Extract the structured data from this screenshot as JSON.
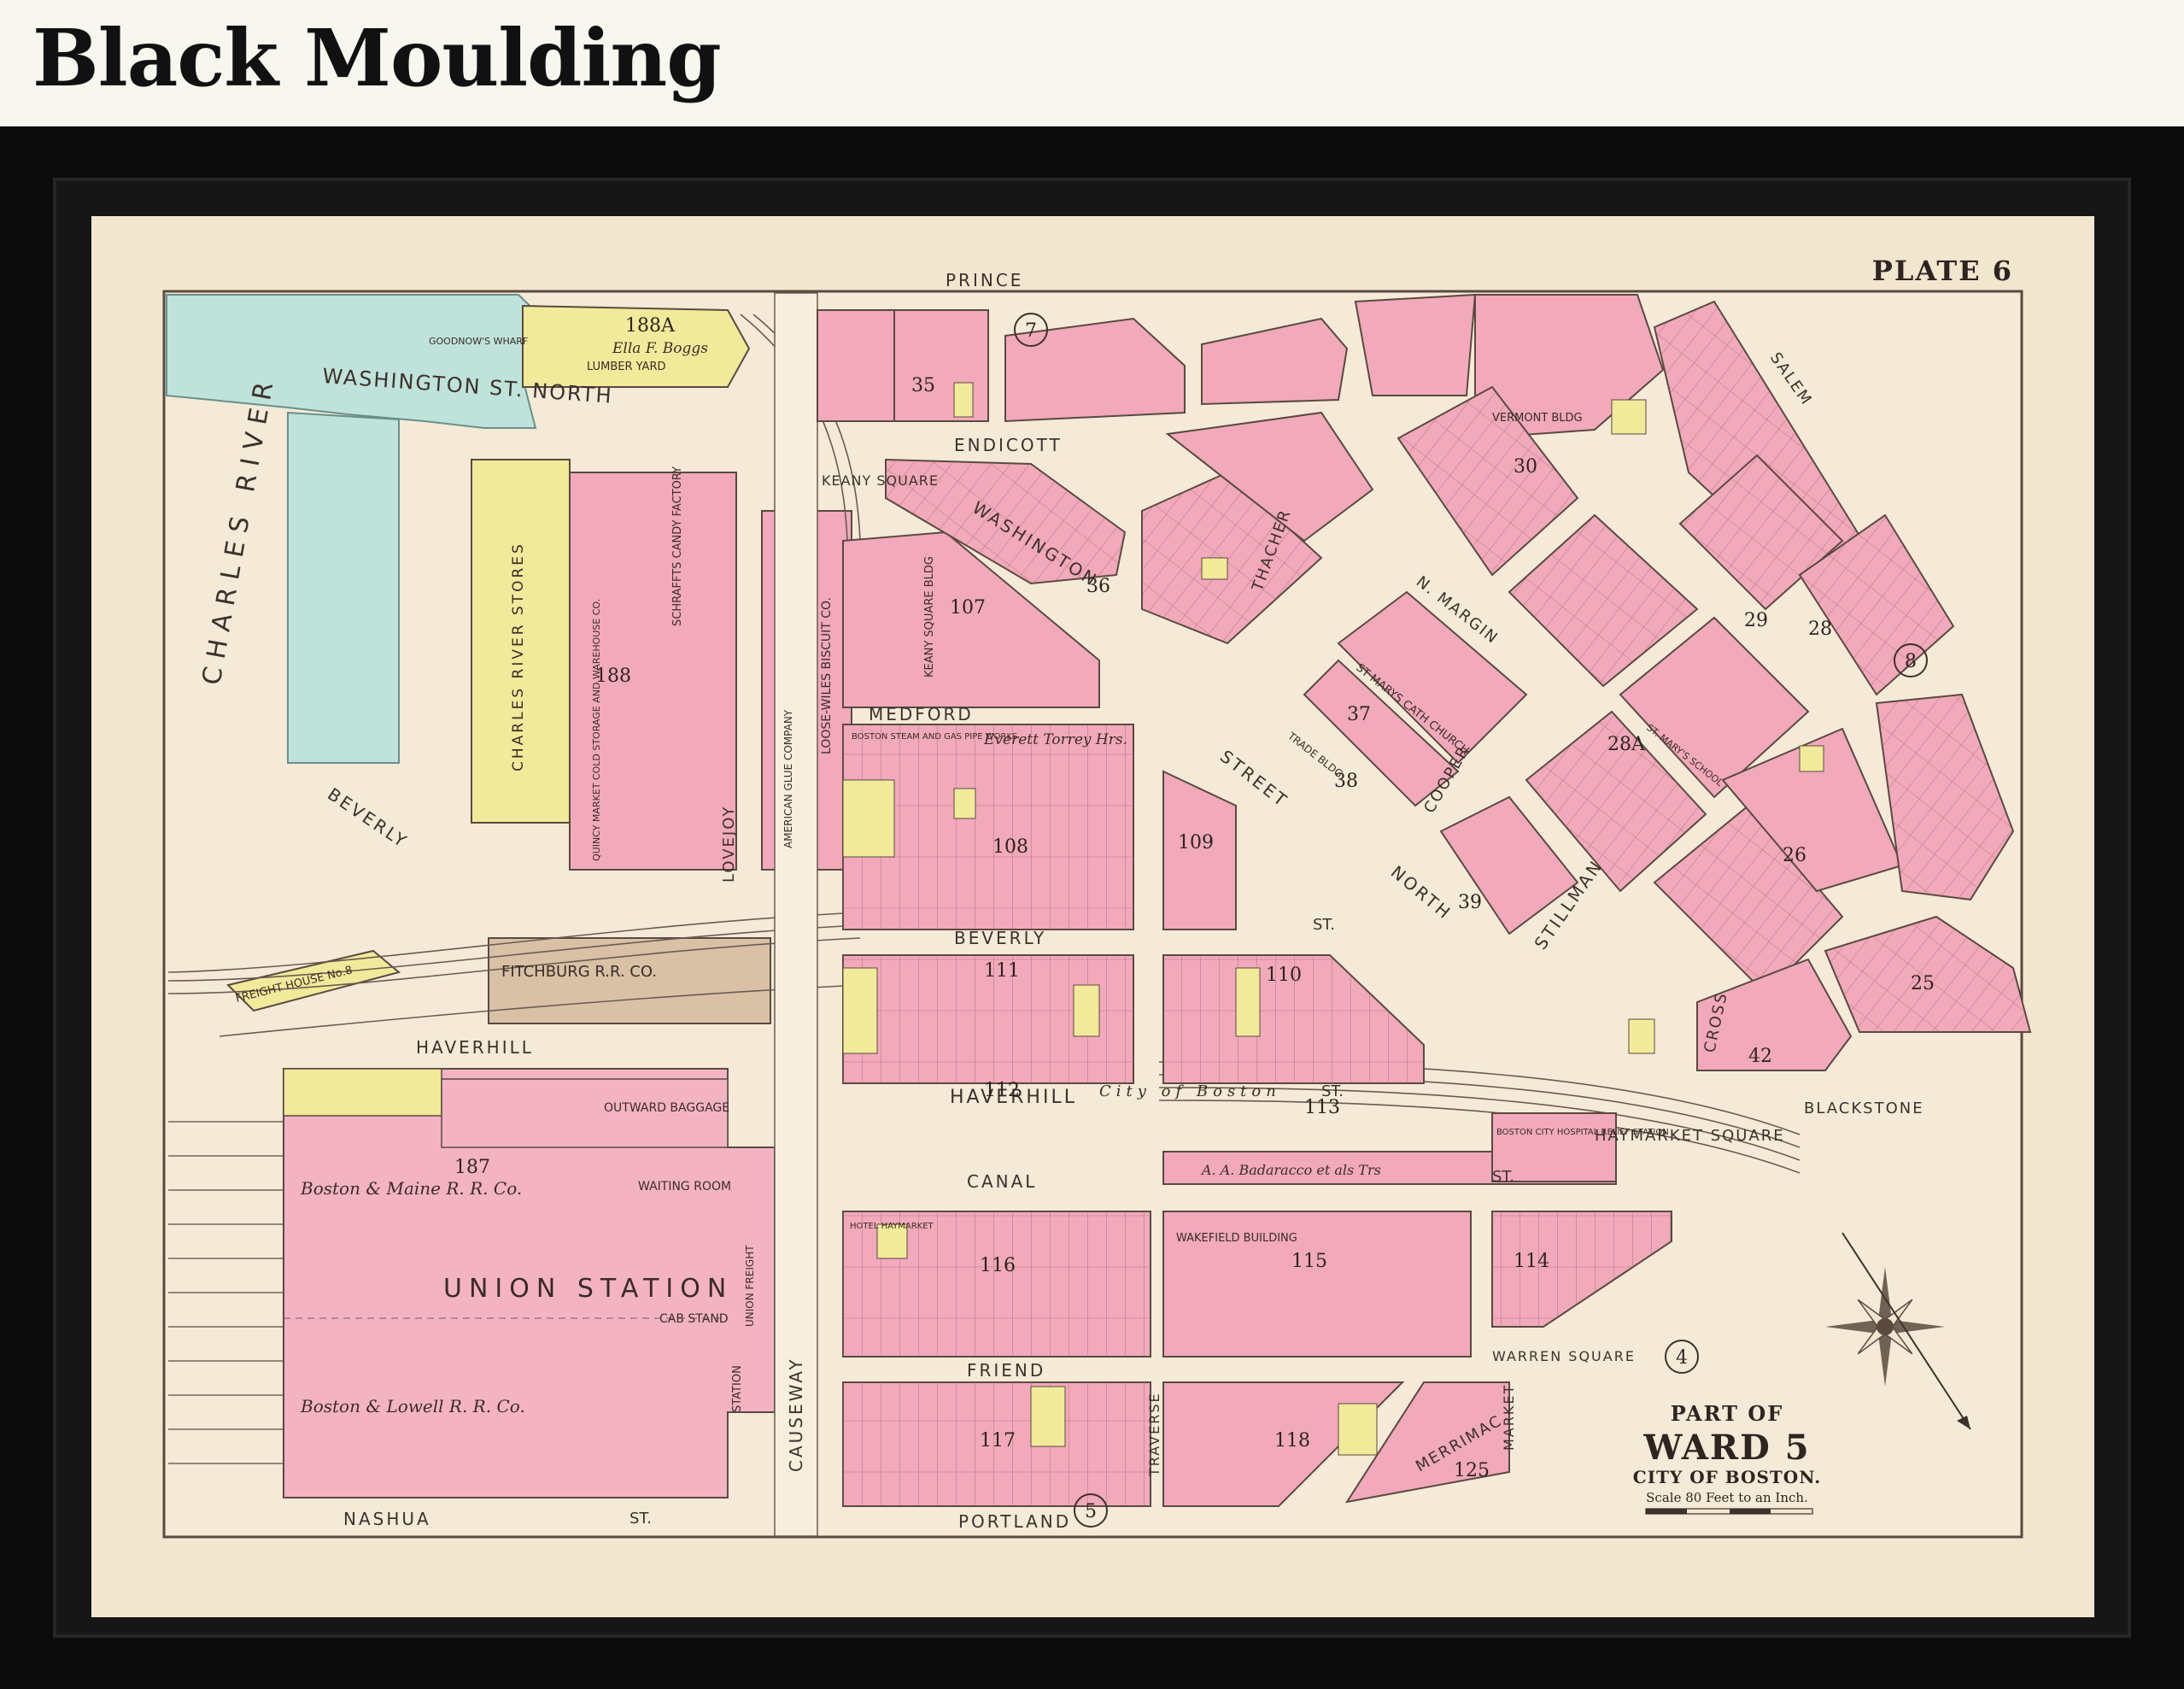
{
  "header": {
    "title": "Black Moulding"
  },
  "colors": {
    "paper": "#f2e6cf",
    "street": "#f4e9d6",
    "pink_block": "#f1a9bb",
    "pink_light": "#f6c1cf",
    "yellow_block": "#f1ea9a",
    "water_teal": "#a9d9d3",
    "tan_building": "#d9c1a6",
    "frame": "#0b0b0b",
    "ink": "#4a3b34"
  },
  "map": {
    "plate": "PLATE 6",
    "river": "CHARLES RIVER",
    "title": {
      "part_of": "PART OF",
      "ward": "WARD 5",
      "city": "CITY OF BOSTON.",
      "scale": "Scale 80 Feet to an Inch."
    },
    "adjacent_plates": [
      "7",
      "8",
      "4",
      "5"
    ],
    "streets": {
      "washington_north": "WASHINGTON  ST.  NORTH",
      "prince": "PRINCE",
      "endicott": "ENDICOTT",
      "washington": "WASHINGTON",
      "medford": "MEDFORD",
      "beverly": "BEVERLY",
      "beverly_st": "BEVERLY",
      "haverhill": "HAVERHILL",
      "haverhill_main": "HAVERHILL",
      "canal": "CANAL",
      "friend": "FRIEND",
      "portland": "PORTLAND",
      "nashua": "NASHUA",
      "causeway": "CAUSEWAY",
      "north_street": "NORTH",
      "street_word": "STREET",
      "thacher": "THACHER",
      "cooper": "COOPER",
      "stillman": "STILLMAN",
      "cross": "CROSS",
      "salem": "SALEM",
      "blackstone": "BLACKSTONE",
      "merrimac": "MERRIMAC",
      "market": "MARKET",
      "traverse": "TRAVERSE",
      "lovejoy": "LOVEJOY",
      "n_margin": "N. MARGIN",
      "keany_square": "KEANY SQUARE",
      "haymarket_square": "HAYMARKET SQUARE",
      "warren_square": "WARREN SQUARE",
      "st": "ST."
    },
    "labels": {
      "union_station": "UNION STATION",
      "boston_maine": "Boston & Maine R. R. Co.",
      "boston_lowell": "Boston & Lowell R. R. Co.",
      "outward_baggage": "OUTWARD BAGGAGE",
      "waiting_room": "WAITING ROOM",
      "cab_stand": "CAB STAND",
      "fitchburg": "FITCHBURG R.R. CO.",
      "freight_house": "FREIGHT HOUSE No.8",
      "charles_river_stores": "CHARLES RIVER STORES",
      "quincy_market": "QUINCY MARKET COLD STORAGE AND WAREHOUSE CO.",
      "schraffts": "SCHRAFFTS CANDY FACTORY",
      "loose_wiles": "LOOSE-WILES BISCUIT CO.",
      "american_glue": "AMERICAN GLUE COMPANY",
      "keany_square_bldg": "KEANY SQUARE BLDG",
      "boston_steam": "BOSTON STEAM AND GAS PIPE WORKS",
      "everett_torrey": "Everett Torrey Hrs.",
      "city_of_boston": "City  of  Boston",
      "badaracco": "A. A. Badaracco et als Trs",
      "boston_city_hospital": "BOSTON CITY HOSPITAL RELIEF STATION",
      "wakefield": "WAKEFIELD BUILDING",
      "hotel_haymarket": "HOTEL HAYMARKET",
      "st_marys_church": "ST MARYS CATH CHURCH",
      "st_marys_school": "ST. MARY'S SCHOOL",
      "vermont_bldg": "VERMONT BLDG",
      "trade_bldg": "TRADE BLDG.",
      "goodnows_wharf": "GOODNOW'S WHARF",
      "lumber_yard": "LUMBER YARD",
      "ella_boggs": "Ella F. Boggs",
      "station": "STATION",
      "union_freight": "UNION FREIGHT"
    },
    "blocks": [
      "188A",
      "188",
      "107",
      "108",
      "109",
      "110",
      "111",
      "112",
      "113",
      "114",
      "115",
      "116",
      "117",
      "118",
      "187",
      "35",
      "36",
      "37",
      "38",
      "39",
      "30",
      "29",
      "28",
      "28A",
      "26",
      "25",
      "42",
      "125"
    ]
  }
}
